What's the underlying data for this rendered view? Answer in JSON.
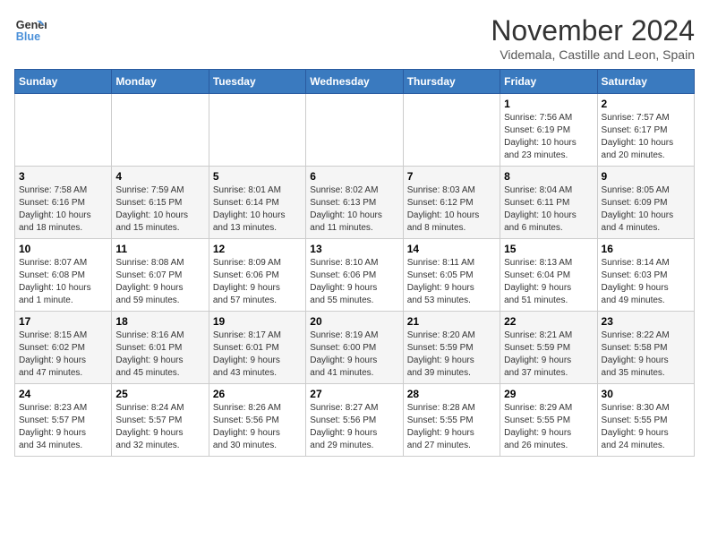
{
  "logo": {
    "line1": "General",
    "line2": "Blue"
  },
  "title": "November 2024",
  "subtitle": "Videmala, Castille and Leon, Spain",
  "days_header": [
    "Sunday",
    "Monday",
    "Tuesday",
    "Wednesday",
    "Thursday",
    "Friday",
    "Saturday"
  ],
  "weeks": [
    [
      {
        "day": "",
        "info": ""
      },
      {
        "day": "",
        "info": ""
      },
      {
        "day": "",
        "info": ""
      },
      {
        "day": "",
        "info": ""
      },
      {
        "day": "",
        "info": ""
      },
      {
        "day": "1",
        "info": "Sunrise: 7:56 AM\nSunset: 6:19 PM\nDaylight: 10 hours\nand 23 minutes."
      },
      {
        "day": "2",
        "info": "Sunrise: 7:57 AM\nSunset: 6:17 PM\nDaylight: 10 hours\nand 20 minutes."
      }
    ],
    [
      {
        "day": "3",
        "info": "Sunrise: 7:58 AM\nSunset: 6:16 PM\nDaylight: 10 hours\nand 18 minutes."
      },
      {
        "day": "4",
        "info": "Sunrise: 7:59 AM\nSunset: 6:15 PM\nDaylight: 10 hours\nand 15 minutes."
      },
      {
        "day": "5",
        "info": "Sunrise: 8:01 AM\nSunset: 6:14 PM\nDaylight: 10 hours\nand 13 minutes."
      },
      {
        "day": "6",
        "info": "Sunrise: 8:02 AM\nSunset: 6:13 PM\nDaylight: 10 hours\nand 11 minutes."
      },
      {
        "day": "7",
        "info": "Sunrise: 8:03 AM\nSunset: 6:12 PM\nDaylight: 10 hours\nand 8 minutes."
      },
      {
        "day": "8",
        "info": "Sunrise: 8:04 AM\nSunset: 6:11 PM\nDaylight: 10 hours\nand 6 minutes."
      },
      {
        "day": "9",
        "info": "Sunrise: 8:05 AM\nSunset: 6:09 PM\nDaylight: 10 hours\nand 4 minutes."
      }
    ],
    [
      {
        "day": "10",
        "info": "Sunrise: 8:07 AM\nSunset: 6:08 PM\nDaylight: 10 hours\nand 1 minute."
      },
      {
        "day": "11",
        "info": "Sunrise: 8:08 AM\nSunset: 6:07 PM\nDaylight: 9 hours\nand 59 minutes."
      },
      {
        "day": "12",
        "info": "Sunrise: 8:09 AM\nSunset: 6:06 PM\nDaylight: 9 hours\nand 57 minutes."
      },
      {
        "day": "13",
        "info": "Sunrise: 8:10 AM\nSunset: 6:06 PM\nDaylight: 9 hours\nand 55 minutes."
      },
      {
        "day": "14",
        "info": "Sunrise: 8:11 AM\nSunset: 6:05 PM\nDaylight: 9 hours\nand 53 minutes."
      },
      {
        "day": "15",
        "info": "Sunrise: 8:13 AM\nSunset: 6:04 PM\nDaylight: 9 hours\nand 51 minutes."
      },
      {
        "day": "16",
        "info": "Sunrise: 8:14 AM\nSunset: 6:03 PM\nDaylight: 9 hours\nand 49 minutes."
      }
    ],
    [
      {
        "day": "17",
        "info": "Sunrise: 8:15 AM\nSunset: 6:02 PM\nDaylight: 9 hours\nand 47 minutes."
      },
      {
        "day": "18",
        "info": "Sunrise: 8:16 AM\nSunset: 6:01 PM\nDaylight: 9 hours\nand 45 minutes."
      },
      {
        "day": "19",
        "info": "Sunrise: 8:17 AM\nSunset: 6:01 PM\nDaylight: 9 hours\nand 43 minutes."
      },
      {
        "day": "20",
        "info": "Sunrise: 8:19 AM\nSunset: 6:00 PM\nDaylight: 9 hours\nand 41 minutes."
      },
      {
        "day": "21",
        "info": "Sunrise: 8:20 AM\nSunset: 5:59 PM\nDaylight: 9 hours\nand 39 minutes."
      },
      {
        "day": "22",
        "info": "Sunrise: 8:21 AM\nSunset: 5:59 PM\nDaylight: 9 hours\nand 37 minutes."
      },
      {
        "day": "23",
        "info": "Sunrise: 8:22 AM\nSunset: 5:58 PM\nDaylight: 9 hours\nand 35 minutes."
      }
    ],
    [
      {
        "day": "24",
        "info": "Sunrise: 8:23 AM\nSunset: 5:57 PM\nDaylight: 9 hours\nand 34 minutes."
      },
      {
        "day": "25",
        "info": "Sunrise: 8:24 AM\nSunset: 5:57 PM\nDaylight: 9 hours\nand 32 minutes."
      },
      {
        "day": "26",
        "info": "Sunrise: 8:26 AM\nSunset: 5:56 PM\nDaylight: 9 hours\nand 30 minutes."
      },
      {
        "day": "27",
        "info": "Sunrise: 8:27 AM\nSunset: 5:56 PM\nDaylight: 9 hours\nand 29 minutes."
      },
      {
        "day": "28",
        "info": "Sunrise: 8:28 AM\nSunset: 5:55 PM\nDaylight: 9 hours\nand 27 minutes."
      },
      {
        "day": "29",
        "info": "Sunrise: 8:29 AM\nSunset: 5:55 PM\nDaylight: 9 hours\nand 26 minutes."
      },
      {
        "day": "30",
        "info": "Sunrise: 8:30 AM\nSunset: 5:55 PM\nDaylight: 9 hours\nand 24 minutes."
      }
    ]
  ]
}
